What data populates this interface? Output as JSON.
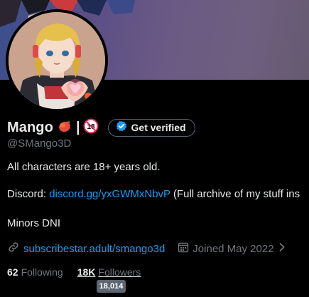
{
  "profile": {
    "display_name": "Mango",
    "separator": "|",
    "age_badge": "18",
    "verify_button": "Get verified",
    "handle": "@SMango3D",
    "bio": {
      "line1": "All characters are 18+ years old.",
      "discord_prefix": "Discord: ",
      "discord_link": "discord.gg/yxGWMxNbvP",
      "discord_suffix": " (Full archive of my stuff ins",
      "line3": "Minors DNI"
    },
    "website": "subscribestar.adult/smango3d",
    "joined": "Joined May 2022",
    "following_count": "62",
    "following_label": "Following",
    "followers_count": "18K",
    "followers_label": "Followers",
    "followers_tooltip": "18,014"
  },
  "icons": {
    "mango": "mango-emoji",
    "age_restricted": "no-under-18-icon",
    "verified": "verified-check-icon",
    "link": "link-icon",
    "calendar": "calendar-icon",
    "chevron": "chevron-right-icon"
  },
  "colors": {
    "background": "#000000",
    "text": "#e7e9ea",
    "muted": "#71767b",
    "link": "#1d9bf0",
    "verify_border": "#536471",
    "tooltip_bg": "#5b6670"
  }
}
